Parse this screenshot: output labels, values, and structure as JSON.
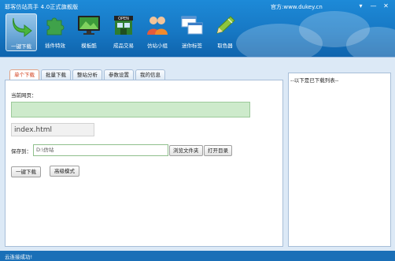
{
  "window": {
    "title": "耶客仿站高手 4.0正式旗舰版",
    "site": "官方:www.dukey.cn",
    "controls": [
      "▾",
      "—",
      "✕"
    ]
  },
  "toolbar": {
    "items": [
      {
        "label": "一键下载",
        "icon": "download-arrow-icon",
        "active": true
      },
      {
        "label": "插件特效",
        "icon": "puzzle-piece-icon"
      },
      {
        "label": "模板酷",
        "icon": "monitor-landscape-icon"
      },
      {
        "label": "成品交易",
        "icon": "shop-open-sign-icon"
      },
      {
        "label": "仿站小组",
        "icon": "people-group-icon"
      },
      {
        "label": "迷你标签",
        "icon": "mini-windows-icon"
      },
      {
        "label": "取色器",
        "icon": "color-picker-pencil-icon"
      }
    ]
  },
  "tabs": [
    {
      "label": "单个下载",
      "active": true
    },
    {
      "label": "批量下载"
    },
    {
      "label": "整站分析"
    },
    {
      "label": "参数设置"
    },
    {
      "label": "我的信息"
    }
  ],
  "form": {
    "current_page_label": "当前网页：",
    "url_value": "",
    "filename_value": "index.html",
    "save_to_label": "保存到：",
    "save_path_value": "D:\\仿站",
    "browse_button": "浏览文件夹",
    "open_dir_button": "打开目录",
    "download_button": "一键下载",
    "advanced_button": "高级模式"
  },
  "side_panel": {
    "label": "--以下是已下载列表--"
  },
  "status": {
    "text": "云连接成功!"
  },
  "colors": {
    "toolbar_blue": "#1778c4",
    "active_tab_text": "#d23b17",
    "url_bar_green": "#cdeacb",
    "status_bar": "#1a6fb7"
  }
}
